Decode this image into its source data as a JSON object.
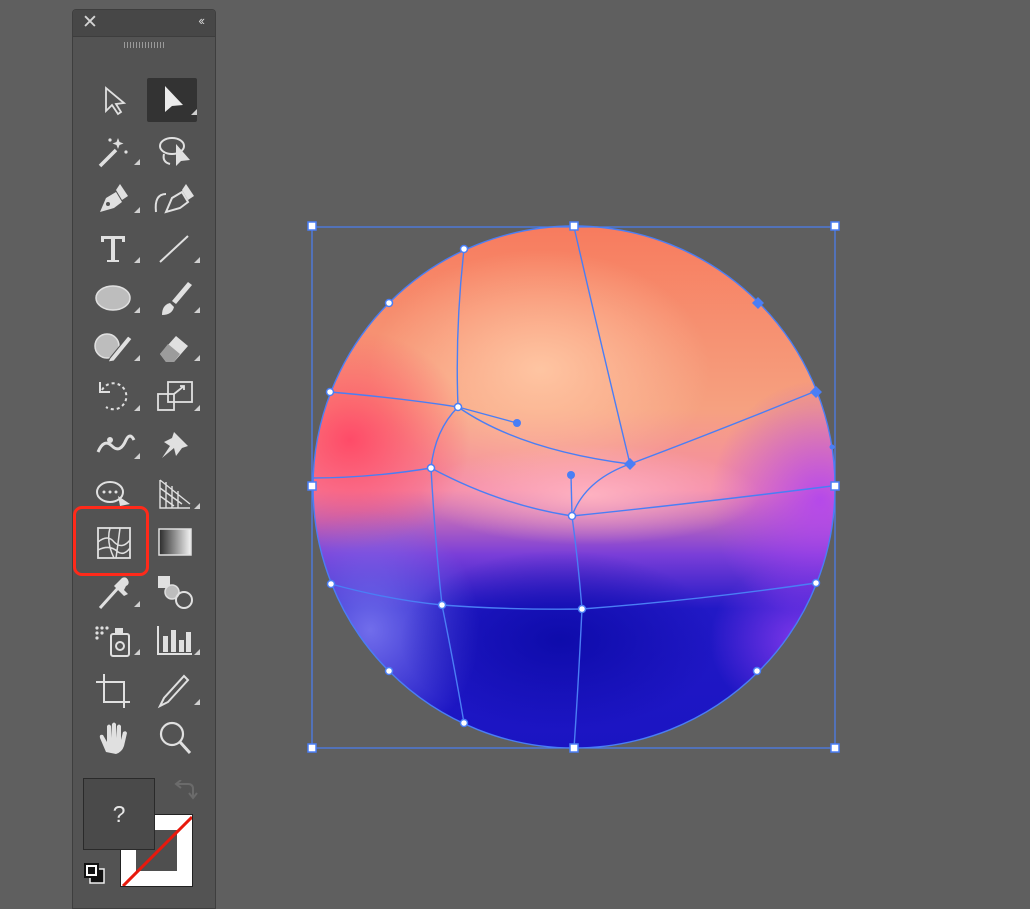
{
  "toolbar": {
    "close_glyph": "✕",
    "collapse_glyph": "‹‹",
    "tools": [
      {
        "name": "selection-tool",
        "icon": "selection-arrow-icon"
      },
      {
        "name": "direct-selection-tool",
        "icon": "direct-selection-arrow-icon",
        "selected": true
      },
      {
        "name": "magic-wand-tool",
        "icon": "magic-wand-icon"
      },
      {
        "name": "lasso-tool",
        "icon": "lasso-icon"
      },
      {
        "name": "pen-tool",
        "icon": "pen-icon"
      },
      {
        "name": "curvature-tool",
        "icon": "curvature-pen-icon"
      },
      {
        "name": "type-tool",
        "icon": "type-icon"
      },
      {
        "name": "line-segment-tool",
        "icon": "line-icon"
      },
      {
        "name": "ellipse-tool",
        "icon": "ellipse-icon"
      },
      {
        "name": "paintbrush-tool",
        "icon": "paintbrush-icon"
      },
      {
        "name": "shaper-tool",
        "icon": "shaper-icon"
      },
      {
        "name": "eraser-tool",
        "icon": "eraser-icon"
      },
      {
        "name": "rotate-tool",
        "icon": "rotate-icon"
      },
      {
        "name": "scale-tool",
        "icon": "scale-icon"
      },
      {
        "name": "warp-tool",
        "icon": "warp-icon"
      },
      {
        "name": "puppet-warp-tool",
        "icon": "pin-icon"
      },
      {
        "name": "free-transform-tool",
        "icon": "free-transform-icon"
      },
      {
        "name": "perspective-grid-tool",
        "icon": "perspective-grid-icon"
      },
      {
        "name": "mesh-tool",
        "icon": "mesh-icon",
        "highlighted": true
      },
      {
        "name": "gradient-tool",
        "icon": "gradient-icon"
      },
      {
        "name": "eyedropper-tool",
        "icon": "eyedropper-icon"
      },
      {
        "name": "blend-tool",
        "icon": "blend-icon"
      },
      {
        "name": "symbol-sprayer-tool",
        "icon": "symbol-sprayer-icon"
      },
      {
        "name": "column-graph-tool",
        "icon": "column-graph-icon"
      },
      {
        "name": "artboard-tool",
        "icon": "artboard-icon"
      },
      {
        "name": "knife-tool",
        "icon": "knife-icon"
      },
      {
        "name": "hand-tool",
        "icon": "hand-icon"
      },
      {
        "name": "zoom-tool",
        "icon": "zoom-icon"
      }
    ],
    "fill_label": "?",
    "colors": {
      "highlight": "#ff2a1a",
      "panel": "#535353",
      "selected_tool": "#333333"
    }
  },
  "canvas": {
    "background": "#5f5f5f",
    "selection_color": "#4a7ef5",
    "gradient_colors": [
      "#ff4f6e",
      "#ffb98e",
      "#f5ab84",
      "#e57ac3",
      "#a549f0",
      "#1a18c9",
      "#6a6be6"
    ]
  }
}
